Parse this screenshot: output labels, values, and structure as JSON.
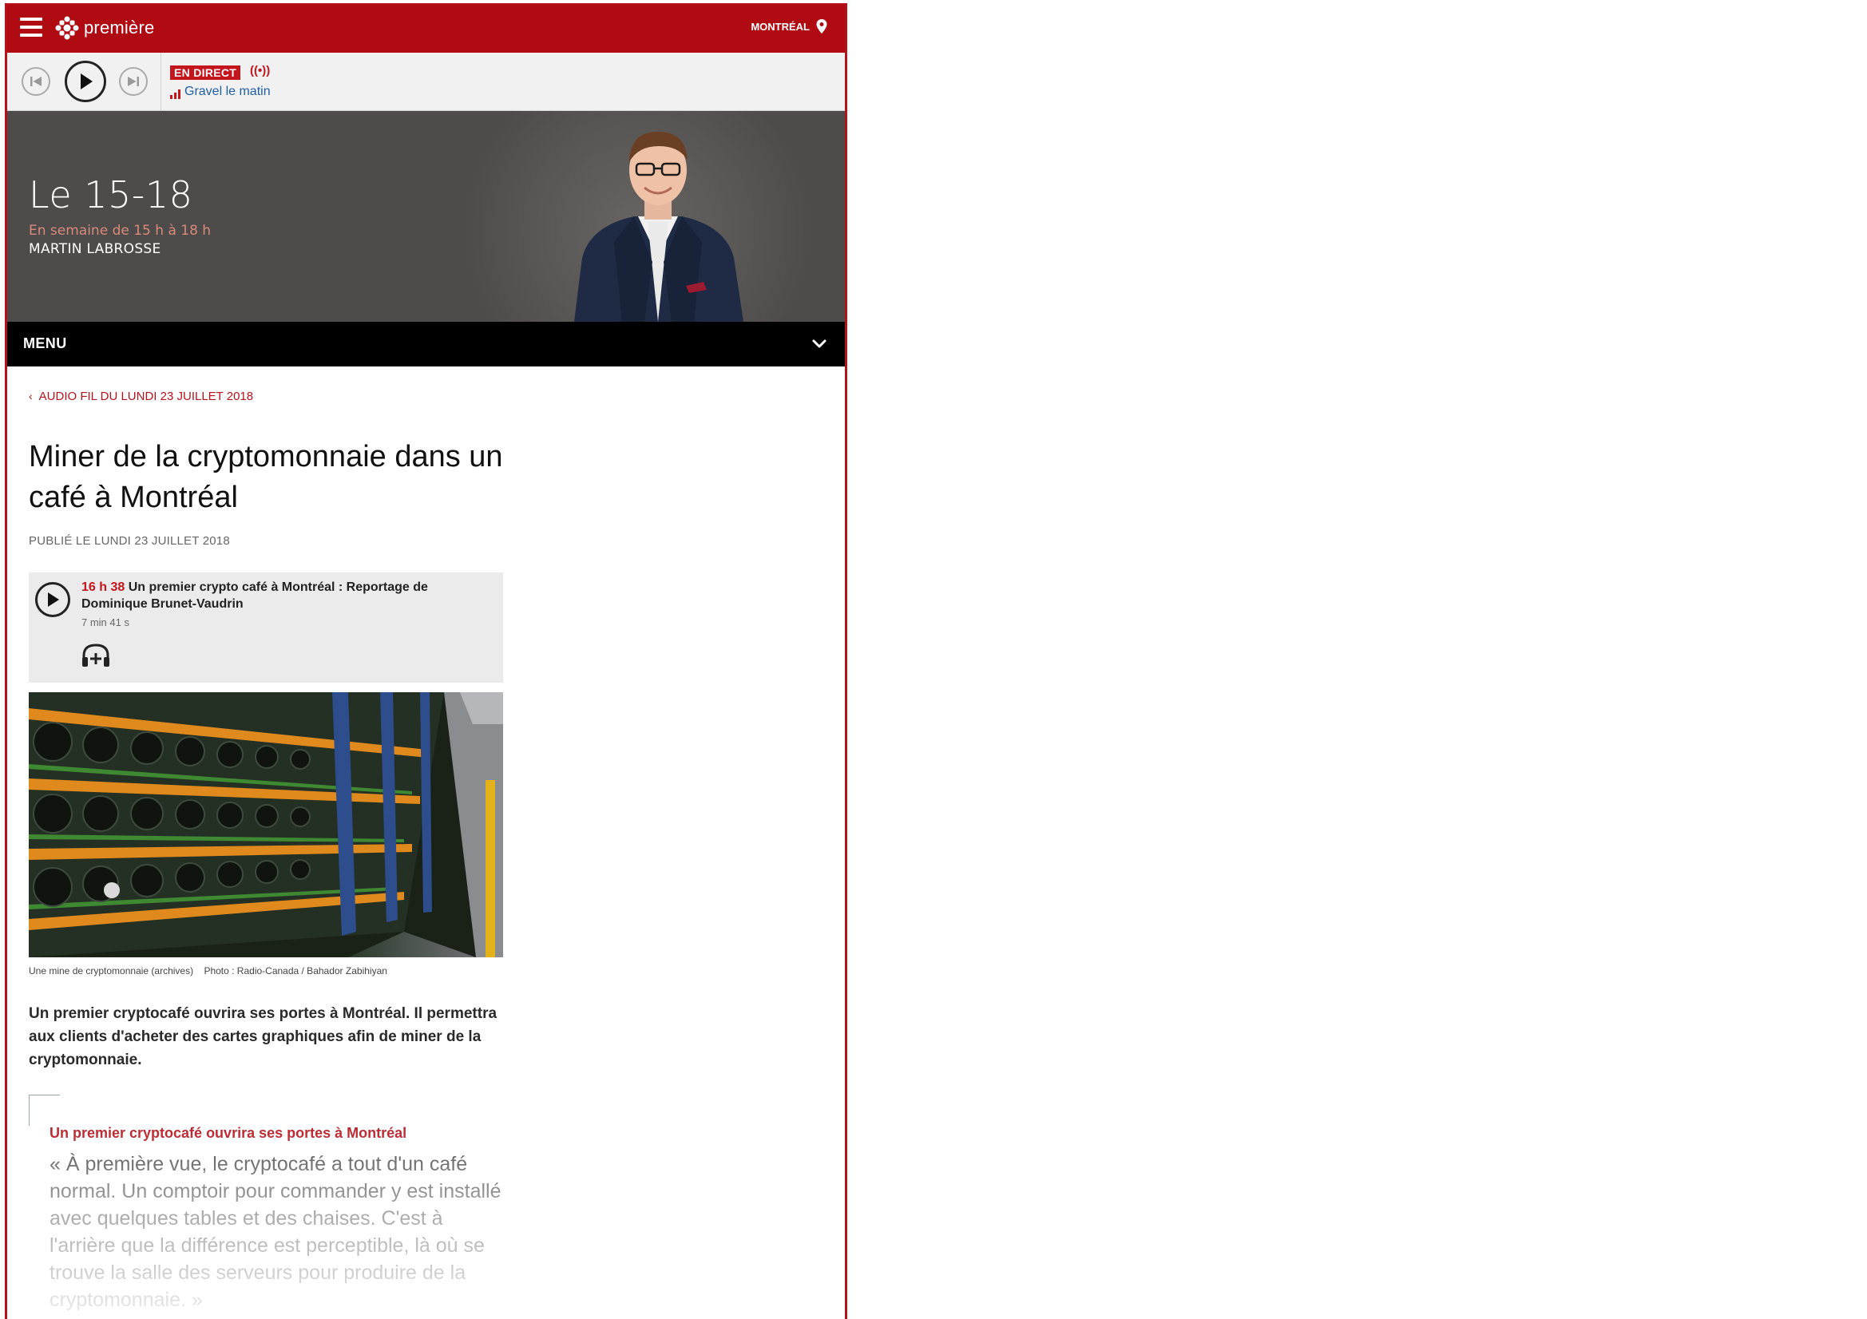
{
  "header": {
    "brand": "première",
    "city": "MONTRÉAL"
  },
  "player": {
    "live_badge": "EN DIRECT",
    "live_waves": "((•))",
    "current_show": "Gravel le matin"
  },
  "hero": {
    "show_title": "Le 15-18",
    "schedule": "En semaine de 15 h à 18 h",
    "host": "MARTIN LABROSSE"
  },
  "menu": {
    "label": "MENU"
  },
  "article": {
    "back_link": "AUDIO FIL DU LUNDI 23 JUILLET 2018",
    "title": "Miner de la cryptomonnaie dans un café à Montréal",
    "published": "PUBLIÉ LE LUNDI 23 JUILLET 2018",
    "audio": {
      "time": "16 h 38",
      "title": "Un premier crypto café à Montréal : Reportage de Dominique Brunet-Vaudrin",
      "duration": "7 min 41 s"
    },
    "photo_caption": "Une mine de cryptomonnaie (archives)",
    "photo_credit": "Photo : Radio-Canada / Bahador Zabihiyan",
    "lead": "Un premier cryptocafé ouvrira ses portes à Montréal. Il permettra aux clients d'acheter des cartes graphiques afin de miner de la cryptomonnaie.",
    "quote_heading": "Un premier cryptocafé ouvrira ses portes à Montréal",
    "quote_body": "« À première vue, le cryptocafé a tout d'un café normal. Un comptoir pour commander y est installé avec quelques tables et des chaises. C'est à l'arrière que la différence est perceptible, là où se trouve la salle des serveurs pour produire de la cryptomonnaie. »"
  },
  "colors": {
    "brand_red": "#b00a13",
    "link_red": "#b5121b",
    "link_blue": "#1f5fa5"
  }
}
